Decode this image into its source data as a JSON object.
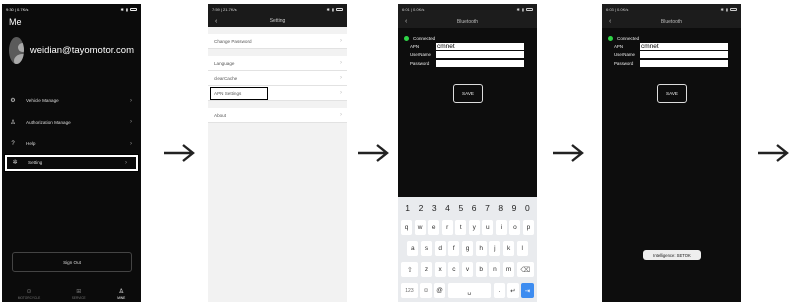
{
  "screen1": {
    "status_time": "9:30 | 0.7K/s",
    "title": "Me",
    "email": "weidian@tayomotor.com",
    "menu": [
      {
        "label": "Vehicle Manage",
        "icon": "gear-icon"
      },
      {
        "label": "Authorization Manage",
        "icon": "user-key-icon"
      },
      {
        "label": "Help",
        "icon": "help-icon"
      },
      {
        "label": "Setting",
        "icon": "settings-icon"
      }
    ],
    "signout": "Sign Out",
    "tabs": [
      "MOTORCYCLE",
      "SERVICE",
      "MINE"
    ]
  },
  "screen2": {
    "status_time": "7:59 | 21.7K/s",
    "title": "Setting",
    "group1": [
      "Change Password"
    ],
    "group2": [
      "Language",
      "clearCache",
      "APN Settings"
    ],
    "group3": [
      "About"
    ]
  },
  "screen3": {
    "status_time": "6:01 | 0.0K/s",
    "title": "Bluetooth",
    "connected": "Connected",
    "apn_label": "APN",
    "apn_value": "cmnet",
    "user_label": "UserName",
    "pass_label": "Password",
    "save": "SAVE",
    "numbers": [
      "1",
      "2",
      "3",
      "4",
      "5",
      "6",
      "7",
      "8",
      "9",
      "0"
    ],
    "row1": [
      "q",
      "w",
      "e",
      "r",
      "t",
      "y",
      "u",
      "i",
      "o",
      "p"
    ],
    "row2": [
      "a",
      "s",
      "d",
      "f",
      "g",
      "h",
      "j",
      "k",
      "l"
    ],
    "row3": [
      "z",
      "x",
      "c",
      "v",
      "b",
      "n",
      "m"
    ],
    "key_123": "123"
  },
  "screen4": {
    "status_time": "6:03 | 0.0K/s",
    "title": "Bluetooth",
    "connected": "Connected",
    "apn_label": "APN",
    "apn_value": "cmnet",
    "user_label": "UserName",
    "pass_label": "Password",
    "save": "SAVE",
    "toast": "Intelligence: SETOK"
  },
  "colors": {
    "connected_dot": "#2fd447",
    "enter_key": "#3d8cf0"
  }
}
